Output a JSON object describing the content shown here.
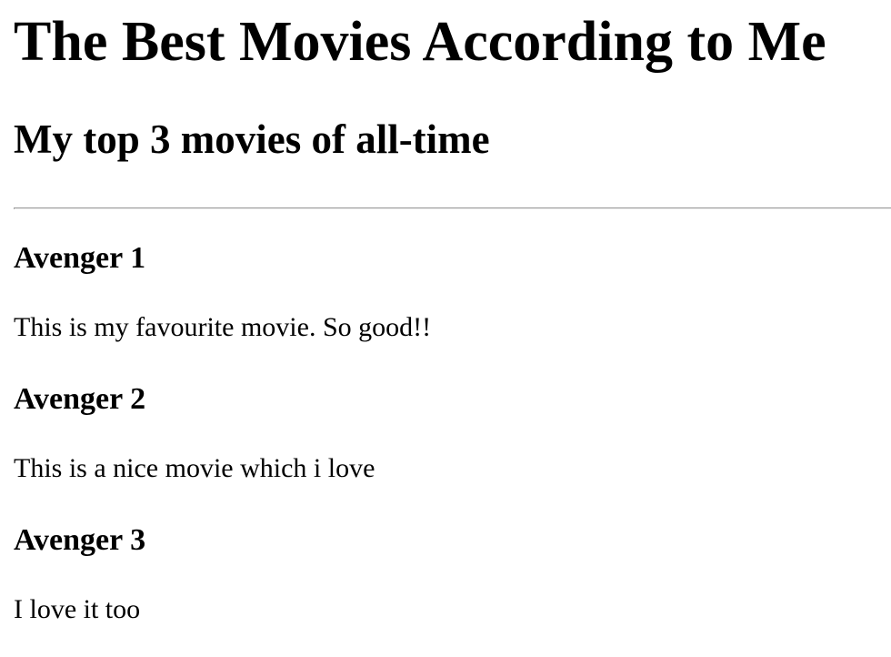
{
  "page": {
    "title": "The Best Movies According to Me",
    "subtitle": "My top 3 movies of all-time"
  },
  "movies": [
    {
      "title": "Avenger 1",
      "description": "This is my favourite movie. So good!!"
    },
    {
      "title": "Avenger 2",
      "description": "This is a nice movie which i love"
    },
    {
      "title": "Avenger 3",
      "description": "I love it too"
    }
  ]
}
